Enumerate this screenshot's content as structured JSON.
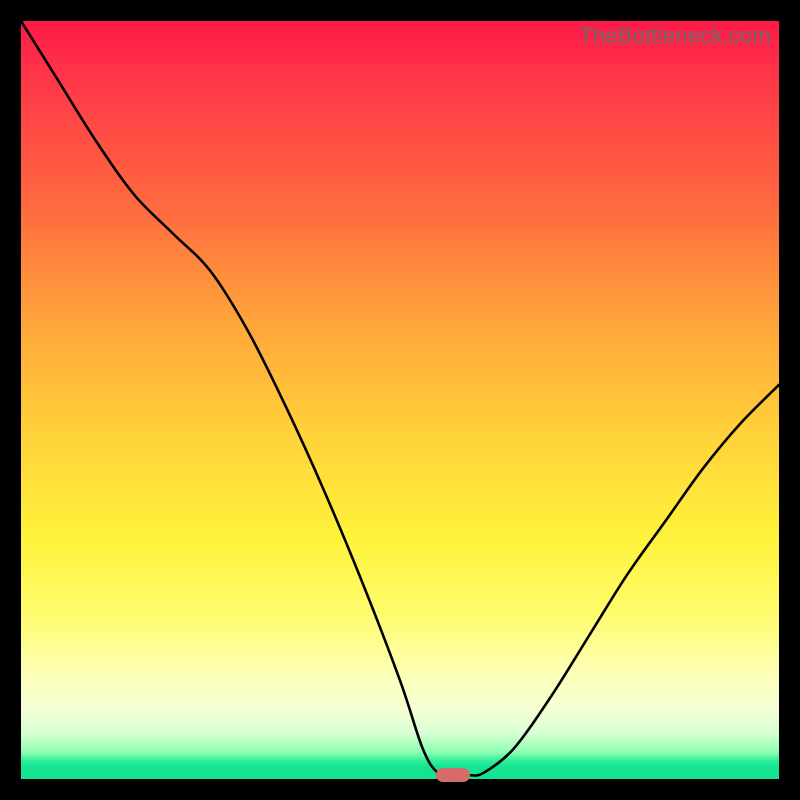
{
  "watermark": "TheBottleneck.com",
  "colors": {
    "frame": "#000000",
    "gradient_top": "#fe1a47",
    "gradient_mid": "#ffd33a",
    "gradient_bottom": "#13e491",
    "curve": "#000000",
    "marker": "#d66b6b"
  },
  "chart_data": {
    "type": "line",
    "title": "",
    "xlabel": "",
    "ylabel": "",
    "xlim": [
      0,
      100
    ],
    "ylim": [
      0,
      100
    ],
    "x": [
      0,
      5,
      10,
      15,
      20,
      25,
      30,
      35,
      40,
      45,
      50,
      53,
      55,
      57,
      59,
      61,
      65,
      70,
      75,
      80,
      85,
      90,
      95,
      100
    ],
    "values": [
      100,
      92,
      84,
      77,
      72,
      67,
      59,
      49,
      38,
      26,
      13,
      4,
      0.8,
      0.5,
      0.5,
      0.8,
      4,
      11,
      19,
      27,
      34,
      41,
      47,
      52
    ],
    "annotations": [
      {
        "type": "marker",
        "x": 57,
        "y": 0.5,
        "shape": "pill",
        "color": "#d66b6b"
      }
    ],
    "notes": "Axes are unlabeled in the source image; x and y normalized to 0–100. Curve touches minimum (~0.5) near x≈57."
  }
}
